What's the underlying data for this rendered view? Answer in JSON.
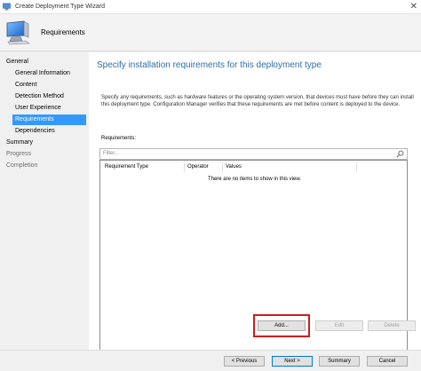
{
  "window": {
    "title": "Create Deployment Type Wizard",
    "close_glyph": "✕"
  },
  "banner": {
    "title": "Requirements",
    "icon": "computer-icon"
  },
  "nav": {
    "items": [
      {
        "label": "General",
        "level": "top",
        "state": "normal"
      },
      {
        "label": "General Information",
        "level": "sub",
        "state": "normal"
      },
      {
        "label": "Content",
        "level": "sub",
        "state": "normal"
      },
      {
        "label": "Detection Method",
        "level": "sub",
        "state": "normal"
      },
      {
        "label": "User Experience",
        "level": "sub",
        "state": "normal"
      },
      {
        "label": "Requirements",
        "level": "sub",
        "state": "selected"
      },
      {
        "label": "Dependencies",
        "level": "sub",
        "state": "normal"
      },
      {
        "label": "Summary",
        "level": "top",
        "state": "normal"
      },
      {
        "label": "Progress",
        "level": "top",
        "state": "muted"
      },
      {
        "label": "Completion",
        "level": "top",
        "state": "muted"
      }
    ]
  },
  "content": {
    "heading": "Specify installation requirements for this deployment type",
    "description": "Specify any requirements, such as hardware features or the operating system version, that devices must have before they can install this deployment type. Configuration Manager verifies that these requirements are met before content is deployed to the device.",
    "requirements_label": "Requirements:",
    "filter_placeholder": "Filter...",
    "columns": [
      "Requirement Type",
      "Operator",
      "Values"
    ],
    "empty_message": "There are no items to show in this view.",
    "buttons": {
      "add": "Add...",
      "edit": "Edit",
      "delete": "Delete"
    }
  },
  "footer": {
    "previous": "< Previous",
    "next": "Next >",
    "summary": "Summary",
    "cancel": "Cancel"
  },
  "colors": {
    "selection": "#3399ff",
    "heading": "#2b6ea8",
    "highlight": "#d11b1b"
  }
}
